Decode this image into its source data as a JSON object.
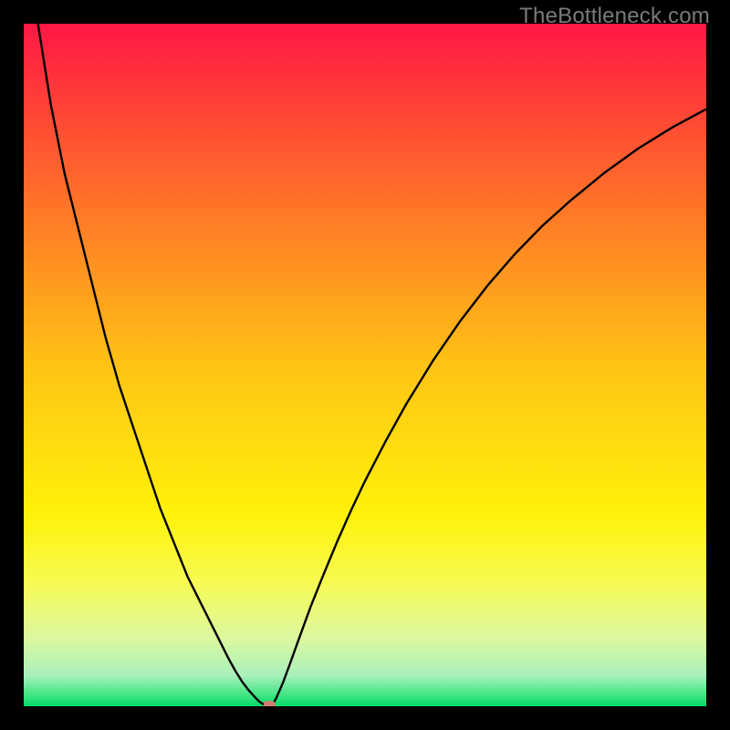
{
  "watermark": "TheBottleneck.com",
  "colors": {
    "frame_border": "#000000",
    "curve": "#000000",
    "marker_fill": "#cf7d71",
    "gradient_stops": [
      {
        "offset": 0.0,
        "color": "#ff1745"
      },
      {
        "offset": 0.25,
        "color": "#ff6f29"
      },
      {
        "offset": 0.5,
        "color": "#ffc315"
      },
      {
        "offset": 0.72,
        "color": "#fff20a"
      },
      {
        "offset": 0.82,
        "color": "#f7fb55"
      },
      {
        "offset": 0.9,
        "color": "#dcf89f"
      },
      {
        "offset": 0.955,
        "color": "#a9f0bb"
      },
      {
        "offset": 0.985,
        "color": "#3be57f"
      },
      {
        "offset": 1.0,
        "color": "#06d968"
      }
    ]
  },
  "chart_data": {
    "type": "line",
    "title": "",
    "xlabel": "",
    "ylabel": "",
    "x_range": [
      0,
      100
    ],
    "y_range": [
      0,
      100
    ],
    "x_min_at": 36,
    "marker": {
      "x": 36,
      "y": 0
    },
    "series": [
      {
        "name": "bottleneck-curve",
        "x": [
          0,
          2,
          4,
          6,
          8,
          10,
          12,
          14,
          16,
          18,
          20,
          22,
          24,
          26,
          28,
          30,
          31,
          32,
          33,
          34,
          34.5,
          35,
          35.5,
          36,
          36.5,
          37,
          38,
          39,
          40,
          42,
          44,
          46,
          48,
          50,
          53,
          56,
          60,
          64,
          68,
          72,
          76,
          80,
          85,
          90,
          95,
          100
        ],
        "y": [
          113,
          100.5,
          88,
          78,
          70,
          62,
          54,
          47,
          41,
          35,
          29,
          24,
          19,
          15,
          11,
          7,
          5.2,
          3.6,
          2.3,
          1.2,
          0.7,
          0.35,
          0.1,
          0,
          0.3,
          1.2,
          3.5,
          6.2,
          9,
          14.5,
          19.5,
          24.3,
          28.8,
          33,
          38.8,
          44.2,
          50.7,
          56.5,
          61.7,
          66.3,
          70.4,
          74,
          78.1,
          81.7,
          84.8,
          87.5
        ]
      }
    ]
  }
}
